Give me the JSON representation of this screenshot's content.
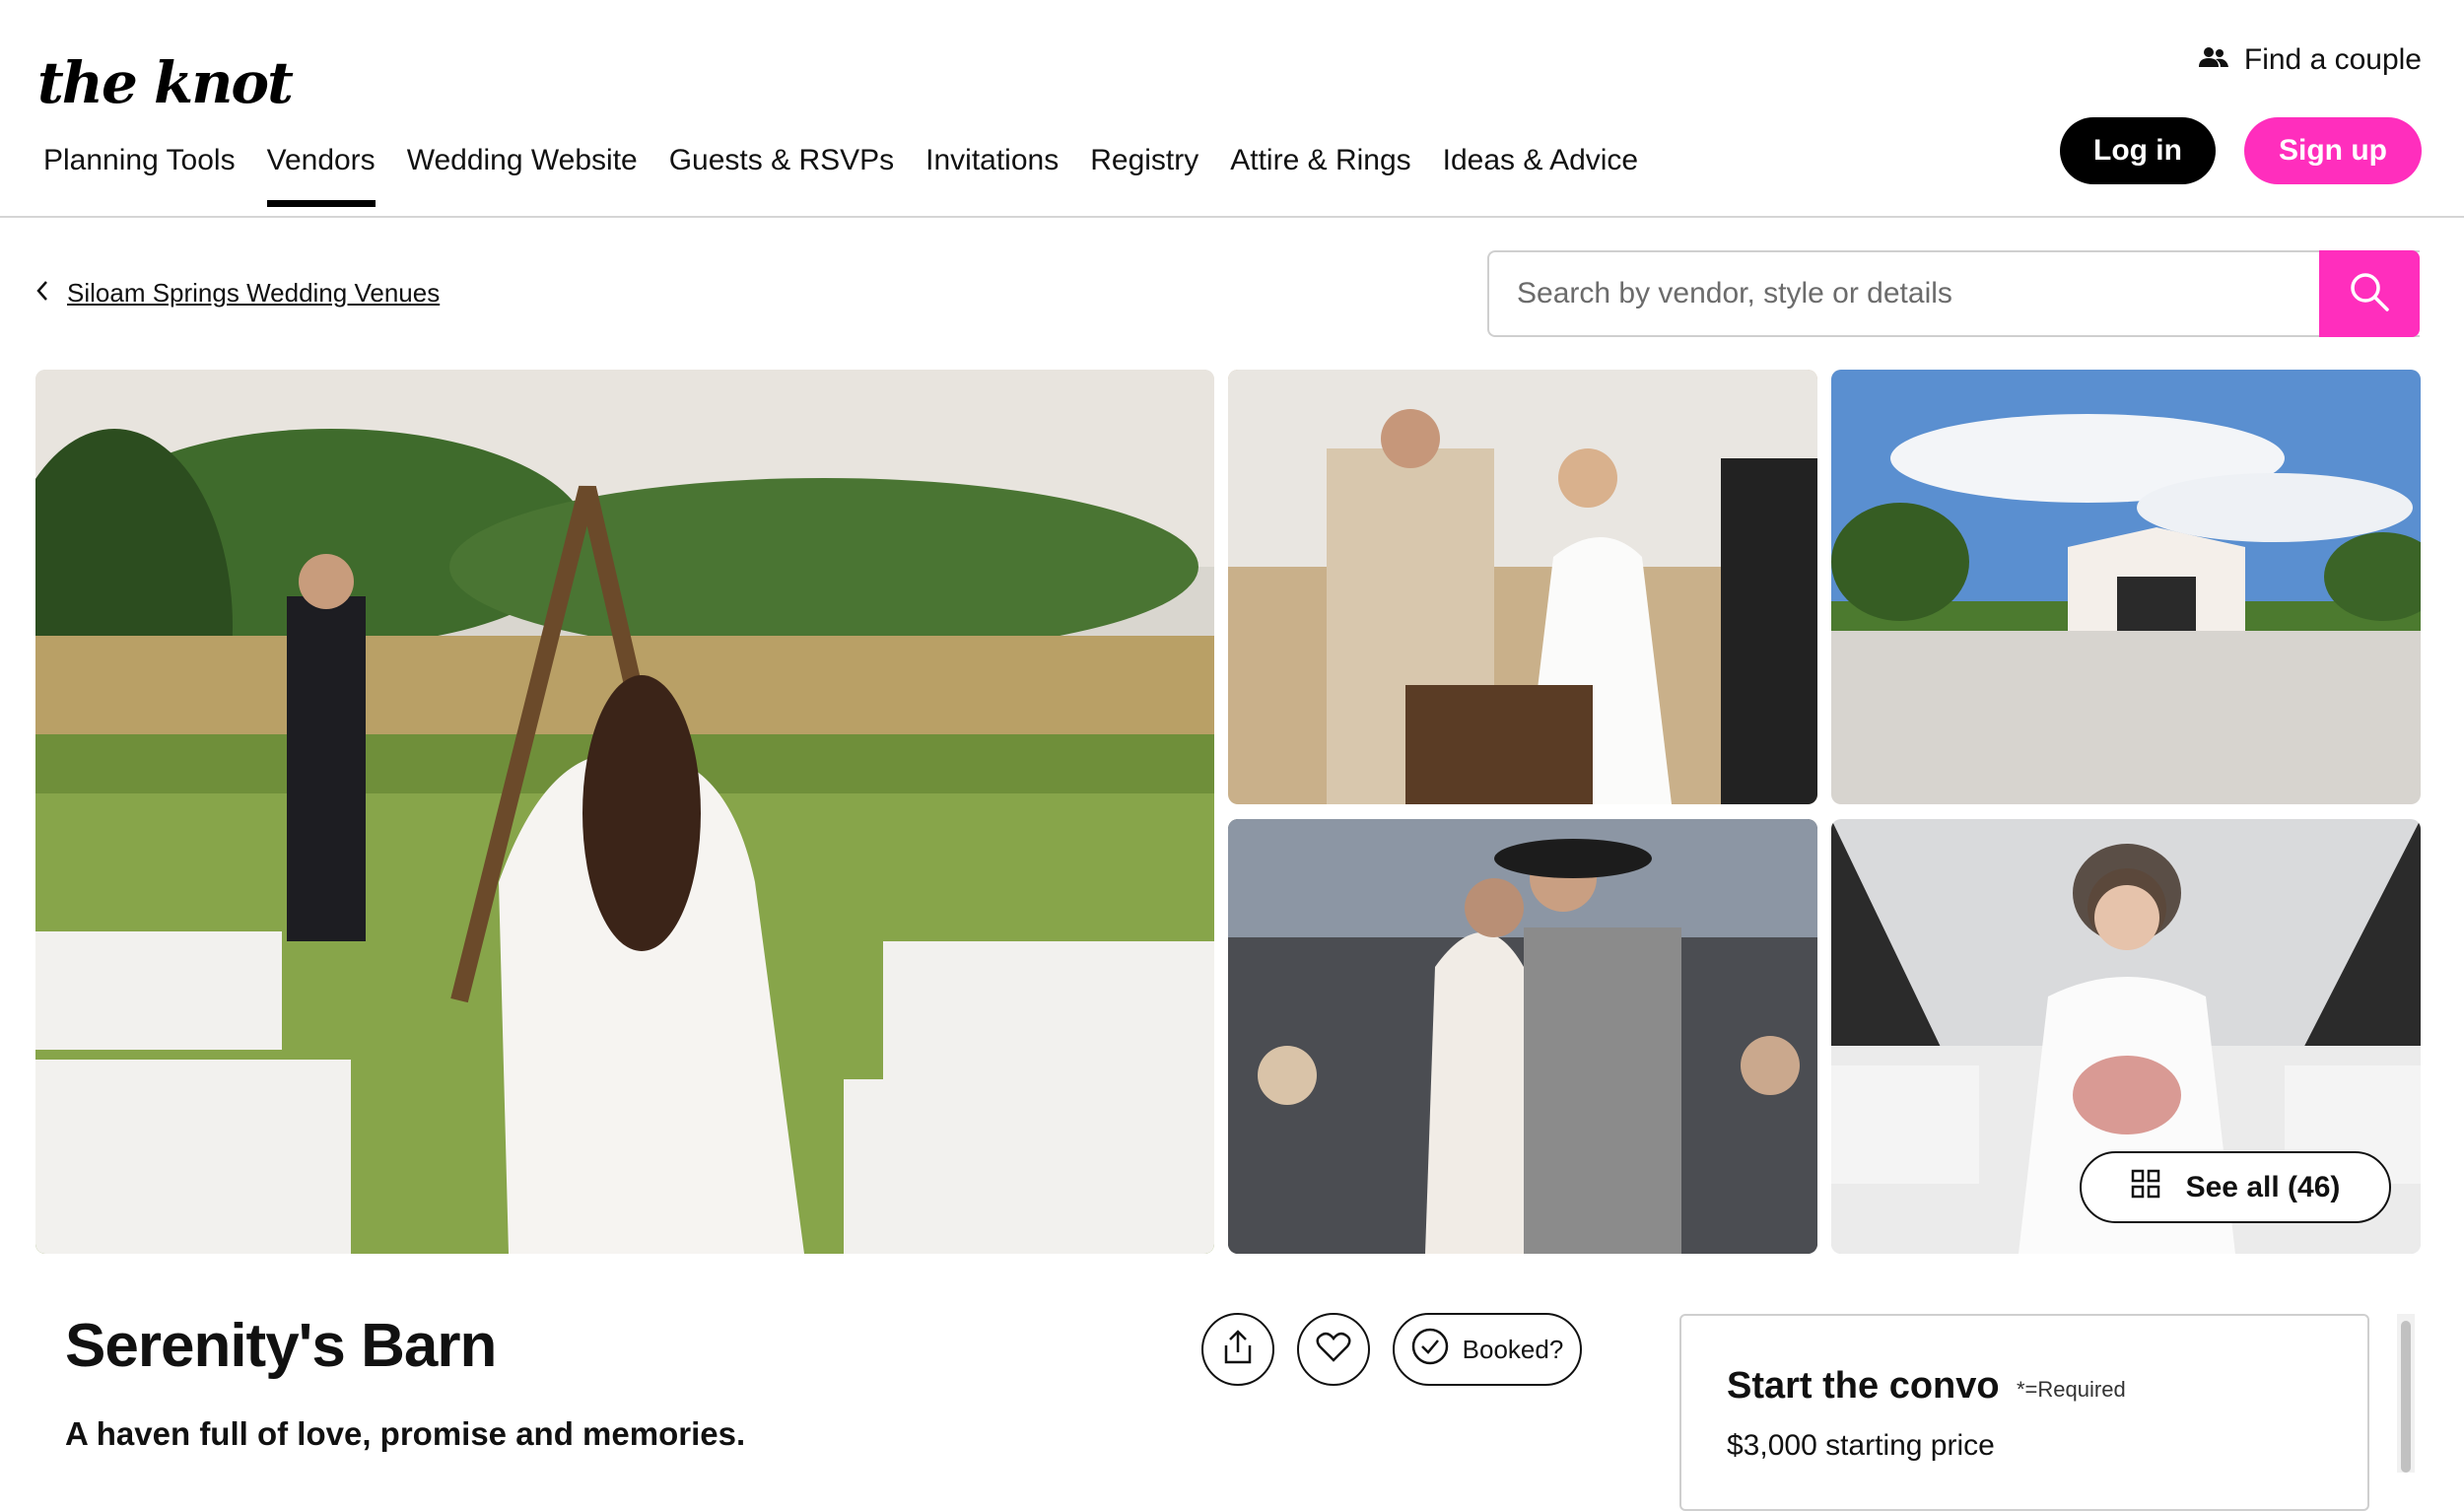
{
  "header": {
    "logo": "the knot",
    "find_couple": "Find a couple",
    "login": "Log in",
    "signup": "Sign up"
  },
  "nav": {
    "items": [
      "Planning Tools",
      "Vendors",
      "Wedding Website",
      "Guests & RSVPs",
      "Invitations",
      "Registry",
      "Attire & Rings",
      "Ideas & Advice"
    ],
    "active": "Vendors"
  },
  "breadcrumb": {
    "label": "Siloam Springs Wedding Venues"
  },
  "search": {
    "placeholder": "Search by vendor, style or details"
  },
  "gallery": {
    "see_all": "See all (46)"
  },
  "vendor": {
    "name": "Serenity's Barn",
    "tagline": "A haven full of love, promise and memories.",
    "booked_label": "Booked?"
  },
  "convo": {
    "title": "Start the convo",
    "required_note": "*=Required",
    "price": "$3,000 starting price"
  },
  "colors": {
    "brand_pink": "#ff2ebd",
    "black": "#000000"
  }
}
